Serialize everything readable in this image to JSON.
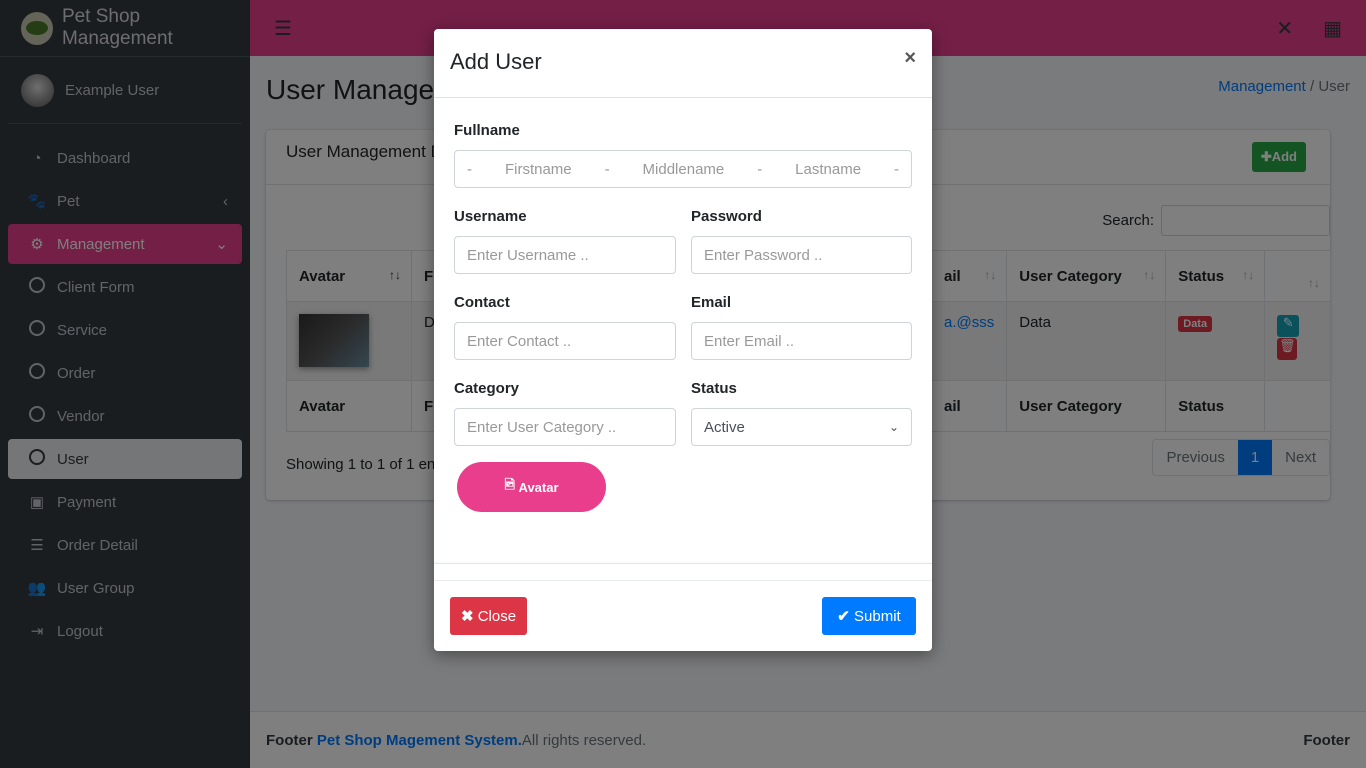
{
  "brand": {
    "title": "Pet Shop Management"
  },
  "user": {
    "name": "Example User"
  },
  "sidebar": {
    "items": [
      {
        "label": "Dashboard",
        "icon": "tachometer-icon"
      },
      {
        "label": "Pet",
        "icon": "paw-icon"
      },
      {
        "label": "Management",
        "icon": "users-cog-icon"
      },
      {
        "label": "Client Form",
        "icon": "circle-icon"
      },
      {
        "label": "Service",
        "icon": "circle-icon"
      },
      {
        "label": "Order",
        "icon": "circle-icon"
      },
      {
        "label": "Vendor",
        "icon": "circle-icon"
      },
      {
        "label": "User",
        "icon": "circle-icon"
      },
      {
        "label": "Payment",
        "icon": "money-icon"
      },
      {
        "label": "Order Detail",
        "icon": "list-icon"
      },
      {
        "label": "User Group",
        "icon": "users-icon"
      },
      {
        "label": "Logout",
        "icon": "sign-out-icon"
      }
    ]
  },
  "page": {
    "title": "User Managen",
    "breadcrumb": [
      "Management",
      "User"
    ]
  },
  "card": {
    "title": "User Management D",
    "add_label": "Add",
    "search_label": "Search:"
  },
  "table": {
    "headers": [
      "Avatar",
      "F",
      "ail",
      "User Category",
      "Status"
    ],
    "row": {
      "fullname": "D",
      "email": "a.@sss",
      "category": "Data",
      "status": "Data"
    },
    "showing": "Showing 1 to 1 of 1 ent",
    "pager": {
      "prev": "Previous",
      "page": "1",
      "next": "Next"
    }
  },
  "footer": {
    "prefix": "Footer",
    "link": "Pet Shop Magement System.",
    "suffix": " All rights reserved.",
    "right": "Footer"
  },
  "modal": {
    "title": "Add User",
    "close_x": "×",
    "fullname_label": "Fullname",
    "sep": "-",
    "first": "Firstname",
    "middle": "Middlename",
    "last": "Lastname",
    "username_label": "Username",
    "username_ph": "Enter Username ..",
    "password_label": "Password",
    "password_ph": "Enter Password ..",
    "contact_label": "Contact",
    "contact_ph": "Enter Contact ..",
    "email_label": "Email",
    "email_ph": "Enter Email ..",
    "category_label": "Category",
    "category_ph": "Enter User Category ..",
    "status_label": "Status",
    "status_value": "Active",
    "avatar_label": "Avatar",
    "close_label": "Close",
    "submit_label": "Submit"
  },
  "colors": {
    "accent": "#e83e8c",
    "sidebar": "#343a40",
    "primary": "#007bff",
    "danger": "#dc3545",
    "success": "#28a745"
  }
}
